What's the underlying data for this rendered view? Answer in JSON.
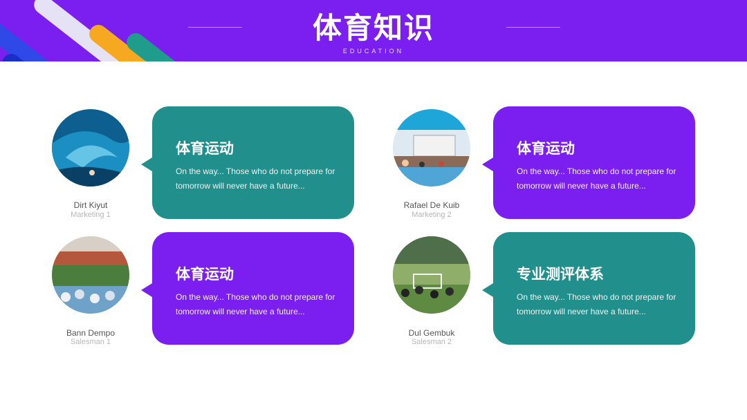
{
  "header": {
    "title": "体育知识",
    "subtitle": "EDUCATION"
  },
  "cards": [
    {
      "name": "Dirt Kiyut",
      "role": "Marketing 1",
      "title": "体育运动",
      "text": "On the way... Those who do not prepare for tomorrow will never have a future...",
      "image": "surfing-wave-photo",
      "color": "#218f8c"
    },
    {
      "name": "Rafael De Kuib",
      "role": "Marketing 2",
      "title": "体育运动",
      "text": "On the way... Those who do not prepare for tomorrow will never have a future...",
      "image": "swimming-pool-photo",
      "color": "#7b1ff0"
    },
    {
      "name": "Bann Dempo",
      "role": "Salesman 1",
      "title": "体育运动",
      "text": "On the way... Those who do not prepare for tomorrow will never have a future...",
      "image": "group-exercise-photo",
      "color": "#7b1ff0"
    },
    {
      "name": "Dul Gembuk",
      "role": "Salesman 2",
      "title": "专业测评体系",
      "text": "On the way... Those who do not prepare for tomorrow will never have a future...",
      "image": "field-training-photo",
      "color": "#218f8c"
    }
  ],
  "colors": {
    "header": "#7b1ff0",
    "teal": "#218f8c",
    "purple": "#7b1ff0",
    "stripe_blue": "#2f49e8",
    "stripe_white": "#e6e2f5",
    "stripe_orange": "#f6a821",
    "stripe_green": "#1f9c8c"
  }
}
